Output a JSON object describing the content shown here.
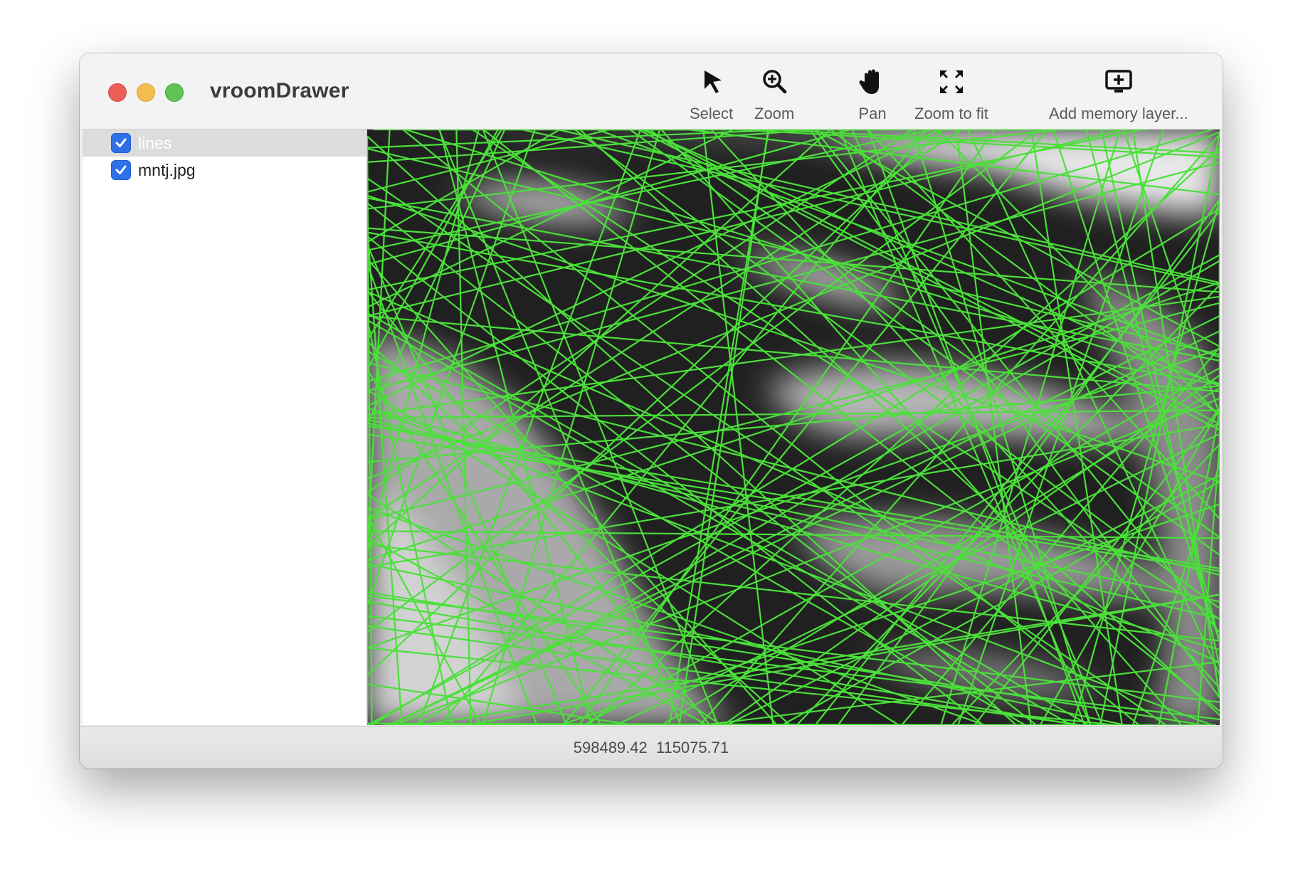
{
  "window": {
    "title": "vroomDrawer"
  },
  "toolbar": {
    "select_label": "Select",
    "zoom_label": "Zoom",
    "pan_label": "Pan",
    "zoom_fit_label": "Zoom to fit",
    "add_layer_label": "Add memory layer..."
  },
  "layers": [
    {
      "label": "lines",
      "checked": true,
      "selected": true
    },
    {
      "label": "mntj.jpg",
      "checked": true,
      "selected": false
    }
  ],
  "status": {
    "coordinates": "598489.42  115075.71"
  },
  "colors": {
    "line_color": "#4be03a",
    "checkbox": "#2f6fe8",
    "selection": "#dcdcdc"
  },
  "icons": [
    "arrow-cursor-icon",
    "zoom-magnifier-icon",
    "hand-icon",
    "expand-arrows-icon",
    "add-display-icon",
    "checkmark-icon"
  ]
}
